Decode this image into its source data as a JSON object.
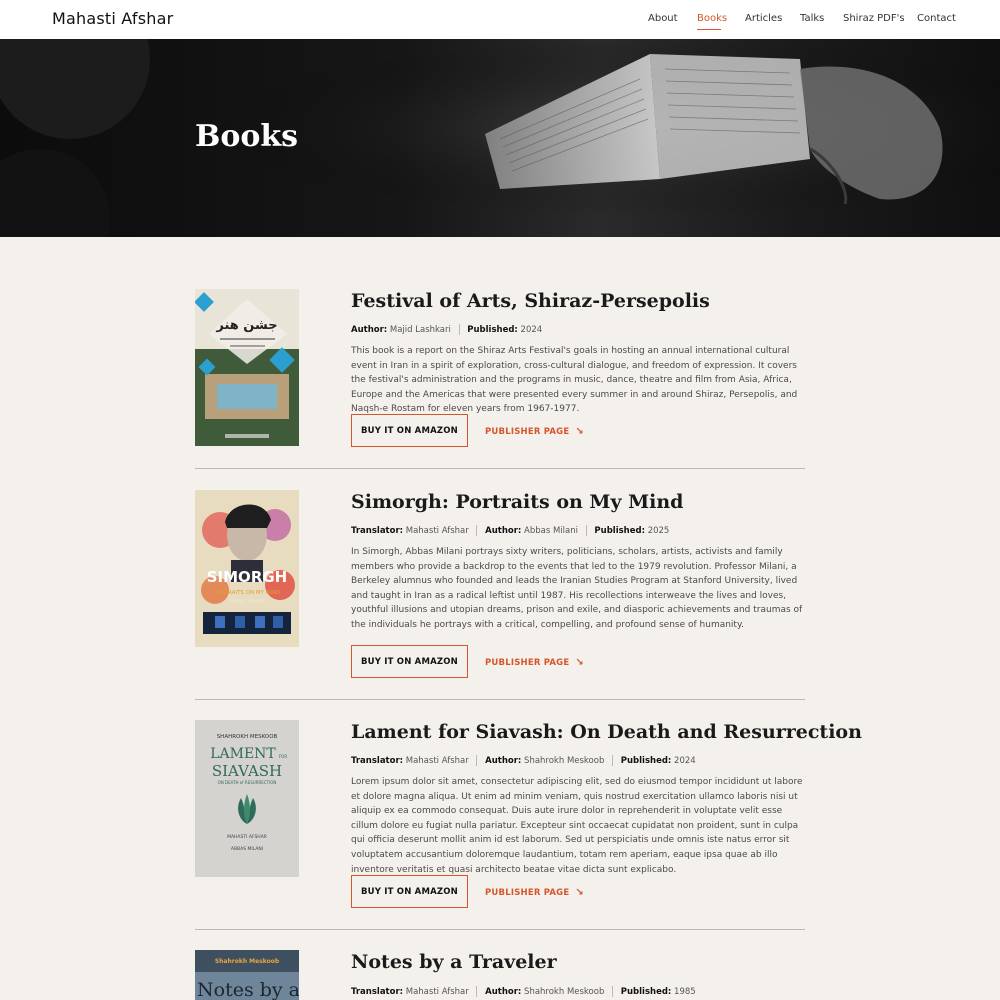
{
  "site": {
    "title": "Mahasti Afshar"
  },
  "nav": {
    "items": [
      {
        "label": "About"
      },
      {
        "label": "Books"
      },
      {
        "label": "Articles"
      },
      {
        "label": "Talks"
      },
      {
        "label": "Shiraz PDF's"
      },
      {
        "label": "Contact"
      }
    ],
    "active": "Books"
  },
  "hero": {
    "title": "Books"
  },
  "labels": {
    "author": "Author:",
    "translator": "Translator:",
    "published": "Published:",
    "buy": "BUY IT ON AMAZON",
    "publisher": "PUBLISHER PAGE"
  },
  "books": [
    {
      "title": "Festival of Arts, Shiraz-Persepolis",
      "author": "Majid Lashkari",
      "published": "2024",
      "description": "This book is a report on the Shiraz Arts Festival's goals in hosting an annual international cultural event in Iran in a spirit of exploration, cross-cultural dialogue, and freedom of expression. It covers the festival's administration and the programs in music, dance, theatre and film from Asia, Africa, Europe and the Americas that were presented every summer in and around Shiraz, Persepolis, and Naqsh-e Rostam for eleven years from 1967-1977."
    },
    {
      "title": "Simorgh: Portraits on My Mind",
      "translator": "Mahasti Afshar",
      "author": "Abbas Milani",
      "published": "2025",
      "cover_title": "SIMORGH",
      "cover_subtitle": "PORTRAITS ON MY MIND",
      "cover_author": "ABBAS MILANI",
      "description": "In Simorgh, Abbas Milani portrays sixty writers, politicians, scholars, artists, activists and family members who provide a backdrop to the events that led to the 1979 revolution. Professor Milani, a Berkeley alumnus who founded and leads the Iranian Studies Program at Stanford University, lived and taught in Iran as a radical leftist until 1987. His recollections interweave the lives and loves, youthful illusions and utopian dreams, prison and exile, and diasporic achievements and traumas of the individuals he portrays with a critical, compelling, and profound sense of humanity."
    },
    {
      "title": "Lament for Siavash: On Death and Resurrection",
      "translator": "Mahasti Afshar",
      "author": "Shahrokh Meskoob",
      "published": "2024",
      "cover_author": "SHAHROKH MESKOOB",
      "cover_title_1": "LAMENT",
      "cover_for": "FOR",
      "cover_title_2": "SIAVASH",
      "cover_subtitle": "ON DEATH of RESURRECTION",
      "cover_translator": "MAHASTI AFSHAR",
      "cover_foreword": "ABBAS MILANI",
      "description": "Lorem ipsum dolor sit amet, consectetur adipiscing elit, sed do eiusmod tempor incididunt ut labore et dolore magna aliqua. Ut enim ad minim veniam, quis nostrud exercitation ullamco laboris nisi ut aliquip ex ea commodo consequat. Duis aute irure dolor in reprehenderit in voluptate velit esse cillum dolore eu fugiat nulla pariatur. Excepteur sint occaecat cupidatat non proident, sunt in culpa qui officia deserunt mollit anim id est laborum. Sed ut perspiciatis unde omnis iste natus error sit voluptatem  accusantium doloremque laudantium, totam rem aperiam, eaque ipsa quae ab illo inventore veritatis et quasi architecto beatae vitae dicta sunt  explicabo."
    },
    {
      "title": "Notes by a Traveler",
      "translator": "Mahasti Afshar",
      "author": "Shahrokh Meskoob",
      "published": "1985",
      "cover_author": "Shahrokh Meskoob",
      "cover_title": "Notes by a"
    }
  ],
  "colors": {
    "accent": "#d5562b",
    "background": "#f4f1ed",
    "header": "#ffffff"
  }
}
